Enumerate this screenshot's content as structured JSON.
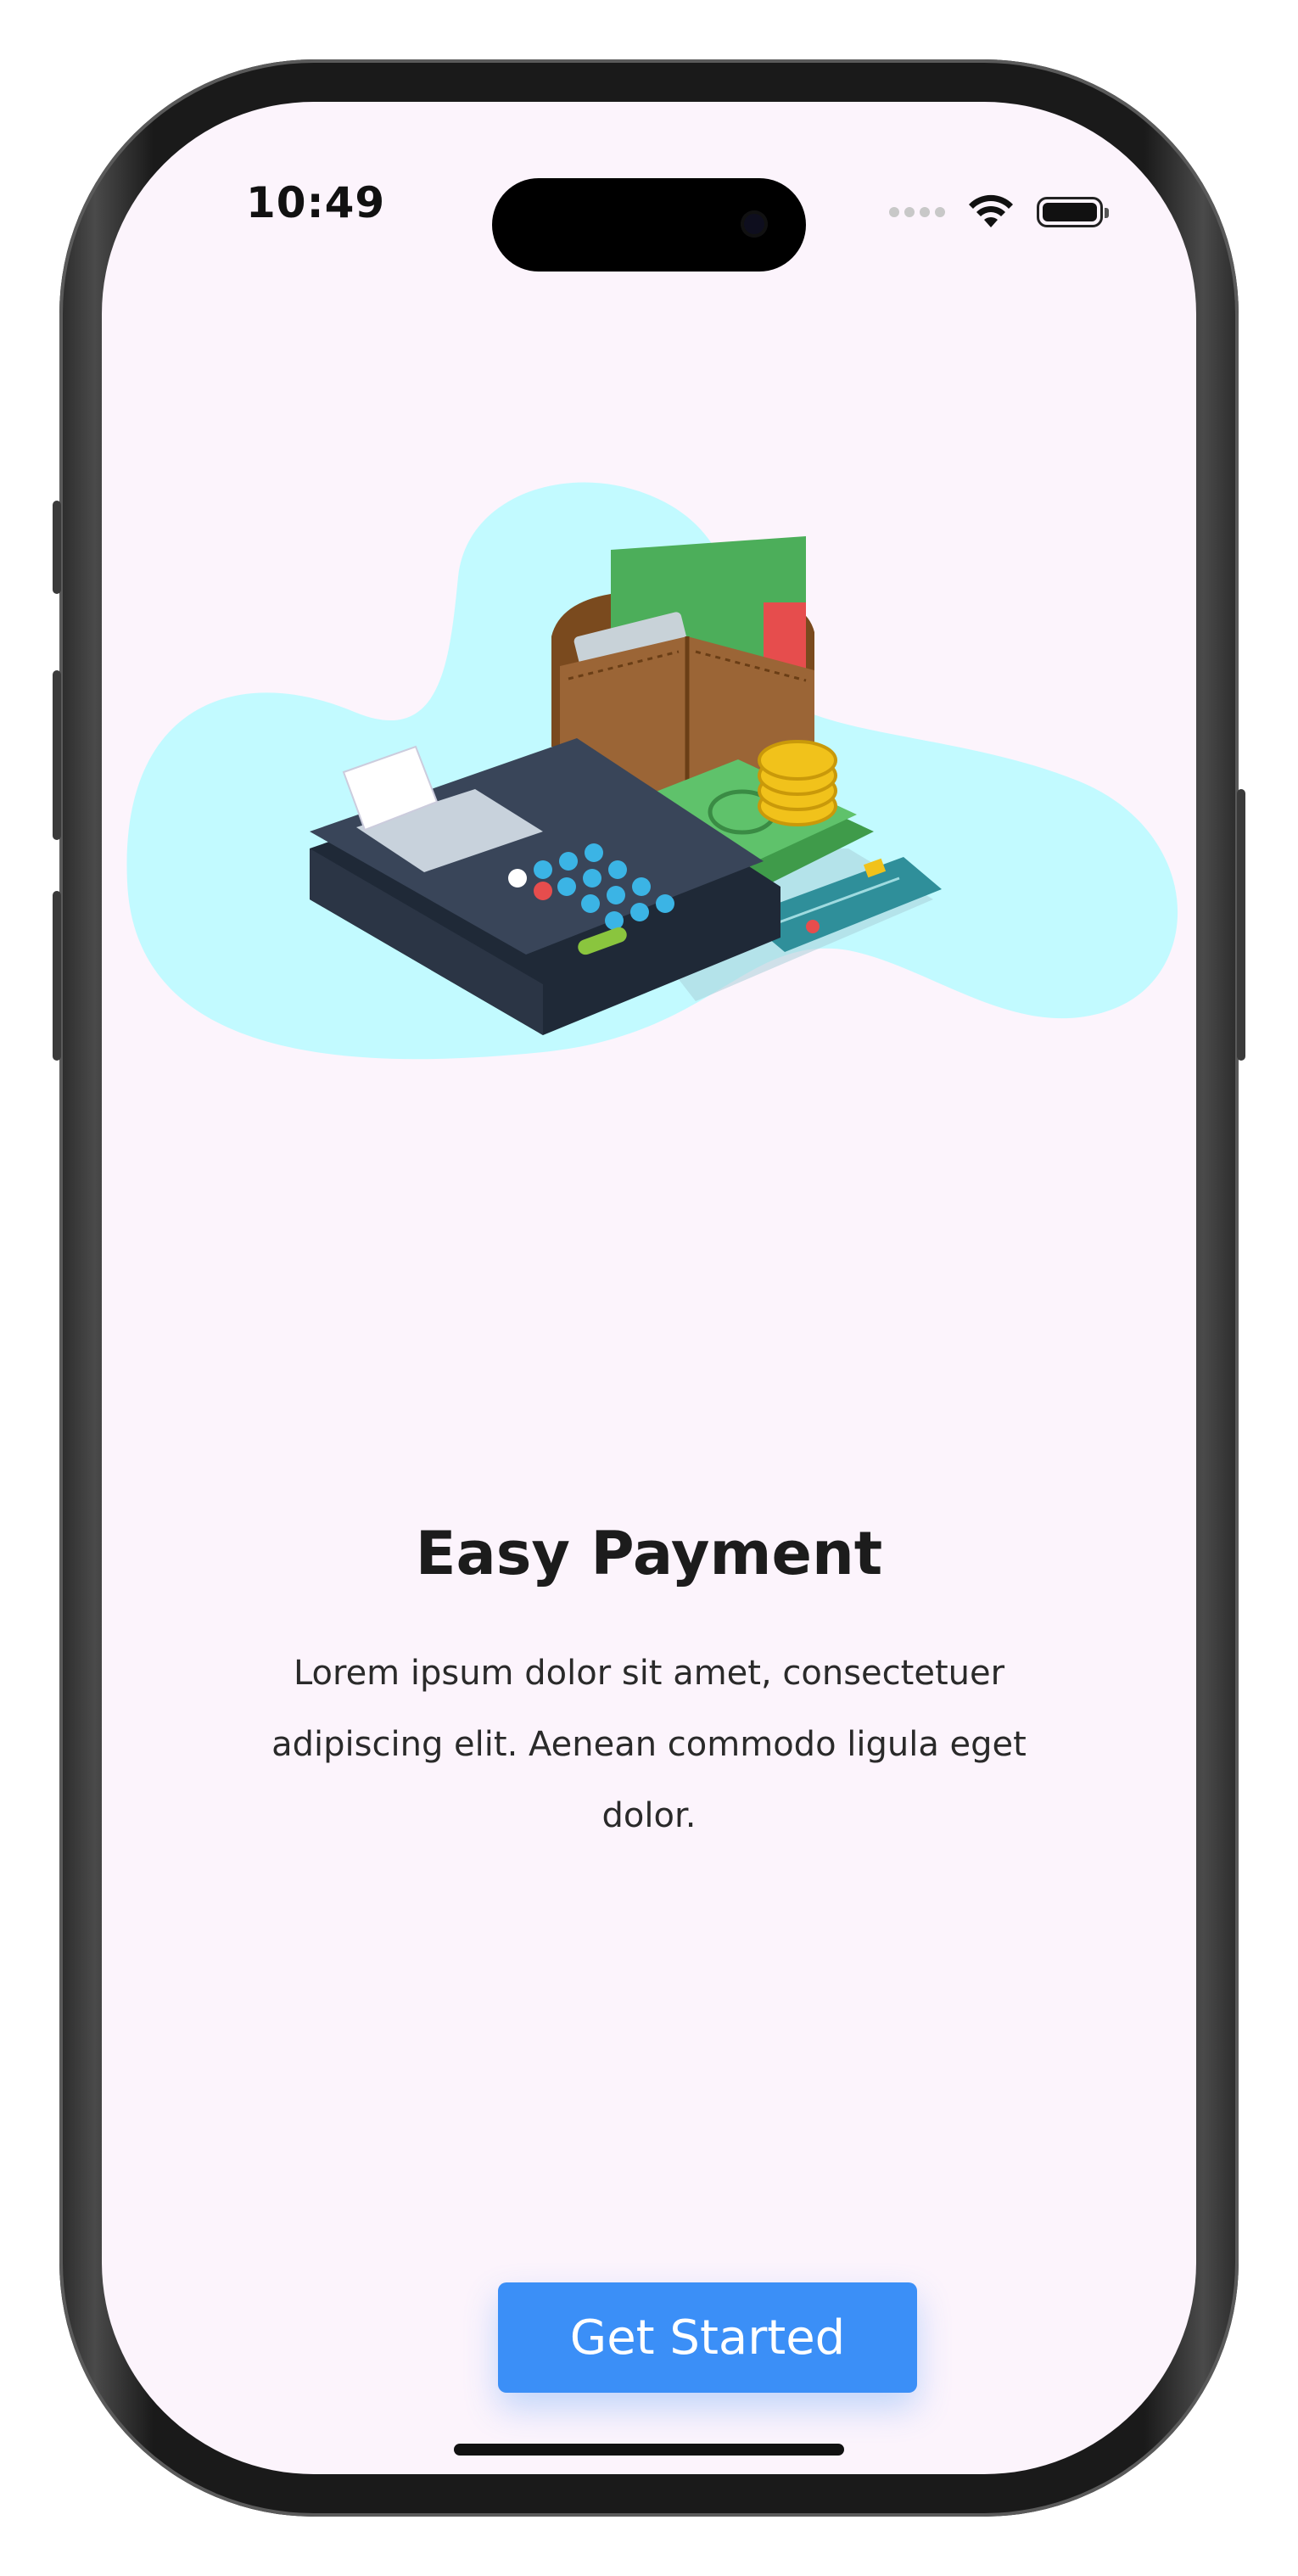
{
  "status_bar": {
    "time": "10:49",
    "icons": [
      "cellular-dots-icon",
      "wifi-icon",
      "battery-icon"
    ]
  },
  "onboarding": {
    "illustration": "payment-illustration",
    "title": "Easy Payment",
    "description": "Lorem ipsum dolor sit amet, consectetuer adipiscing elit. Aenean commodo ligula eget dolor.",
    "cta_label": "Get Started"
  },
  "colors": {
    "background": "#fcf4fc",
    "accent": "#3b8ff7",
    "blob": "#c2faff"
  }
}
